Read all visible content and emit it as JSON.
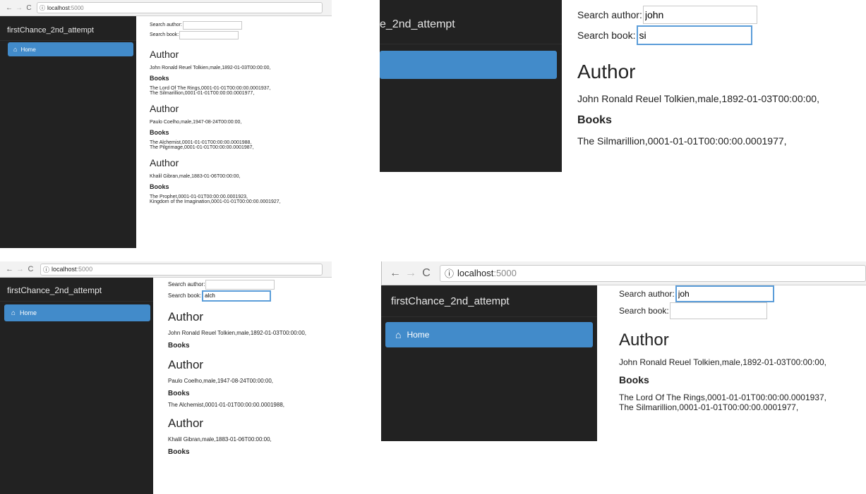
{
  "app": {
    "brand": "firstChance_2nd_attempt",
    "brand_partial": "e_2nd_attempt",
    "home_label": "Home"
  },
  "browser": {
    "host": "localhost",
    "port": ":5000"
  },
  "labels": {
    "search_author": "Search author:",
    "search_book": "Search book:",
    "author_heading": "Author",
    "books_heading": "Books"
  },
  "panels": {
    "tl": {
      "search_author_value": "",
      "search_book_value": "",
      "authors": [
        {
          "info": "John Ronald Reuel Tolkien,male,1892-01-03T00:00:00,",
          "books": [
            "The Lord Of The Rings,0001-01-01T00:00:00.0001937,",
            "The Silmarillion,0001-01-01T00:00:00.0001977,"
          ]
        },
        {
          "info": "Paulo Coelho,male,1947-08-24T00:00:00,",
          "books": [
            "The Alchemist,0001-01-01T00:00:00.0001988,",
            "The Pilgrimage,0001-01-01T00:00:00.0001987,"
          ]
        },
        {
          "info": "Khalil Gibran,male,1883-01-06T00:00:00,",
          "books": [
            "The Prophet,0001-01-01T00:00:00.0001923,",
            "Kingdom of the Imagination,0001-01-01T00:00:00.0001927,"
          ]
        }
      ]
    },
    "tr": {
      "search_author_value": "john",
      "search_book_value": "si",
      "authors": [
        {
          "info": "John Ronald Reuel Tolkien,male,1892-01-03T00:00:00,",
          "books": [
            "The Silmarillion,0001-01-01T00:00:00.0001977,"
          ]
        }
      ]
    },
    "bl": {
      "search_author_value": "",
      "search_book_value": "alch",
      "authors": [
        {
          "info": "John Ronald Reuel Tolkien,male,1892-01-03T00:00:00,",
          "books": []
        },
        {
          "info": "Paulo Coelho,male,1947-08-24T00:00:00,",
          "books": [
            "The Alchemist,0001-01-01T00:00:00.0001988,"
          ]
        },
        {
          "info": "Khalil Gibran,male,1883-01-06T00:00:00,",
          "books": []
        }
      ]
    },
    "br": {
      "search_author_value": "joh",
      "search_book_value": "",
      "authors": [
        {
          "info": "John Ronald Reuel Tolkien,male,1892-01-03T00:00:00,",
          "books": [
            "The Lord Of The Rings,0001-01-01T00:00:00.0001937,",
            "The Silmarillion,0001-01-01T00:00:00.0001977,"
          ]
        }
      ]
    }
  },
  "colors": {
    "sidebar_bg": "#222222",
    "nav_active": "#428bca",
    "focus_border": "#5b9dd9"
  }
}
